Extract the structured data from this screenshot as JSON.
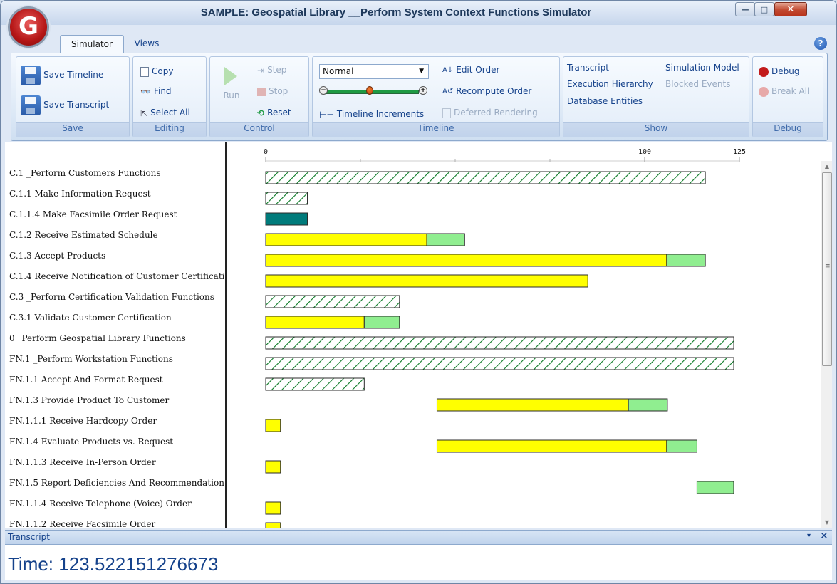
{
  "window": {
    "title": "SAMPLE: Geospatial Library __Perform System Context Functions Simulator",
    "logo_letter": "G"
  },
  "tabs": {
    "simulator": "Simulator",
    "views": "Views",
    "help": "?"
  },
  "ribbon": {
    "save": {
      "label": "Save",
      "save_timeline": "Save Timeline",
      "save_transcript": "Save Transcript"
    },
    "editing": {
      "label": "Editing",
      "copy": "Copy",
      "find": "Find",
      "select_all": "Select All"
    },
    "control": {
      "label": "Control",
      "run": "Run",
      "step": "Step",
      "stop": "Stop",
      "reset": "Reset"
    },
    "timeline": {
      "label": "Timeline",
      "speed": "Normal",
      "edit_order": "Edit Order",
      "recompute_order": "Recompute Order",
      "timeline_increments": "Timeline Increments",
      "deferred_rendering": "Deferred Rendering",
      "zoom_level": 0.48
    },
    "show": {
      "label": "Show",
      "transcript": "Transcript",
      "simulation_model": "Simulation Model",
      "execution_hierarchy": "Execution Hierarchy",
      "blocked_events": "Blocked Events",
      "database_entities": "Database Entities"
    },
    "debug": {
      "label": "Debug",
      "debug": "Debug",
      "break_all": "Break All"
    }
  },
  "colors": {
    "active": "#ffff00",
    "wait": "#90ee90",
    "event": "#007b7b",
    "hatch": "#0b7a26"
  },
  "timeline": {
    "axis": {
      "min": 0,
      "max": 125,
      "tick_labels": [
        {
          "value": 0,
          "text": "0"
        },
        {
          "value": 100,
          "text": "100"
        },
        {
          "value": 125,
          "text": "125"
        }
      ],
      "minor_ticks": [
        25,
        50,
        75
      ]
    },
    "rows": [
      {
        "label": "C.1 _Perform Customers Functions",
        "bars": [
          {
            "type": "hatch",
            "start": 0,
            "end": 116
          }
        ]
      },
      {
        "label": "C.1.1 Make Information Request",
        "bars": [
          {
            "type": "hatch",
            "start": 0,
            "end": 11
          }
        ]
      },
      {
        "label": "C.1.1.4 Make Facsimile Order Request",
        "bars": [
          {
            "type": "event",
            "start": 0,
            "end": 11
          }
        ]
      },
      {
        "label": "C.1.2 Receive Estimated Schedule",
        "bars": [
          {
            "type": "active",
            "start": 0,
            "end": 42.5
          },
          {
            "type": "wait",
            "start": 42.5,
            "end": 52.5
          }
        ]
      },
      {
        "label": "C.1.3 Accept Products",
        "bars": [
          {
            "type": "active",
            "start": 0,
            "end": 105.8
          },
          {
            "type": "wait",
            "start": 105.8,
            "end": 116
          }
        ]
      },
      {
        "label": "C.1.4 Receive Notification of Customer Certification",
        "bars": [
          {
            "type": "active",
            "start": 0,
            "end": 85
          }
        ]
      },
      {
        "label": "C.3 _Perform Certification Validation Functions",
        "bars": [
          {
            "type": "hatch",
            "start": 0,
            "end": 35.3
          }
        ]
      },
      {
        "label": "C.3.1 Validate Customer Certification",
        "bars": [
          {
            "type": "active",
            "start": 0,
            "end": 26
          },
          {
            "type": "wait",
            "start": 26,
            "end": 35.3
          }
        ]
      },
      {
        "label": "0 _Perform Geospatial Library Functions",
        "bars": [
          {
            "type": "hatch",
            "start": 0,
            "end": 123.5
          }
        ]
      },
      {
        "label": "FN.1 _Perform Workstation Functions",
        "bars": [
          {
            "type": "hatch",
            "start": 0,
            "end": 123.5
          }
        ]
      },
      {
        "label": "FN.1.1 Accept And Format Request",
        "bars": [
          {
            "type": "hatch",
            "start": 0,
            "end": 26
          }
        ]
      },
      {
        "label": "FN.1.3 Provide Product To Customer",
        "bars": [
          {
            "type": "active",
            "start": 45.2,
            "end": 95.7
          },
          {
            "type": "wait",
            "start": 95.7,
            "end": 106
          }
        ]
      },
      {
        "label": "FN.1.1.1 Receive Hardcopy Order",
        "bars": [
          {
            "type": "active",
            "start": 0,
            "end": 3.9
          }
        ]
      },
      {
        "label": "FN.1.4 Evaluate Products vs. Request",
        "bars": [
          {
            "type": "active",
            "start": 45.2,
            "end": 105.8
          },
          {
            "type": "wait",
            "start": 105.8,
            "end": 113.8
          }
        ]
      },
      {
        "label": "FN.1.1.3 Receive In-Person Order",
        "bars": [
          {
            "type": "active",
            "start": 0,
            "end": 3.9
          }
        ]
      },
      {
        "label": "FN.1.5 Report Deficiencies And Recommendations",
        "bars": [
          {
            "type": "wait",
            "start": 113.8,
            "end": 123.5
          }
        ]
      },
      {
        "label": "FN.1.1.4 Receive Telephone (Voice) Order",
        "bars": [
          {
            "type": "active",
            "start": 0,
            "end": 3.9
          }
        ]
      },
      {
        "label": "FN.1.1.2 Receive Facsimile Order",
        "bars": [
          {
            "type": "active",
            "start": 0,
            "end": 3.9
          }
        ]
      }
    ]
  },
  "transcript": {
    "title": "Transcript",
    "menu": "▾",
    "close": "✕",
    "time_text": "Time: 123.522151276673"
  }
}
